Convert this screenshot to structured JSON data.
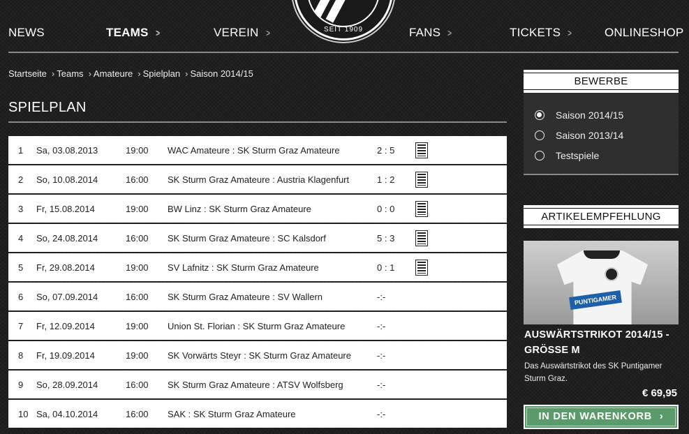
{
  "nav": {
    "items": [
      {
        "label": "NEWS",
        "chevron": false,
        "active": false
      },
      {
        "label": "TEAMS",
        "chevron": true,
        "active": true
      },
      {
        "label": "VEREIN",
        "chevron": true,
        "active": false
      },
      {
        "label": "FANS",
        "chevron": true,
        "active": false
      },
      {
        "label": "TICKETS",
        "chevron": true,
        "active": false
      },
      {
        "label": "ONLINESHOP",
        "chevron": false,
        "active": false
      }
    ],
    "logo_text": "SEIT 1909"
  },
  "breadcrumb": [
    "Startseite",
    "Teams",
    "Amateure",
    "Spielplan",
    "Saison 2014/15"
  ],
  "page_title": "SPIELPLAN",
  "matches": [
    {
      "no": "1",
      "date": "Sa, 03.08.2013",
      "time": "19:00",
      "match": "WAC Amateure : SK Sturm Graz Amateure",
      "score": "2 : 5",
      "report": true
    },
    {
      "no": "2",
      "date": "So, 10.08.2014",
      "time": "16:00",
      "match": "SK Sturm Graz Amateure : Austria Klagenfurt",
      "score": "1 : 2",
      "report": true
    },
    {
      "no": "3",
      "date": "Fr, 15.08.2014",
      "time": "19:00",
      "match": "BW Linz : SK Sturm Graz Amateure",
      "score": "0 : 0",
      "report": true
    },
    {
      "no": "4",
      "date": "So, 24.08.2014",
      "time": "16:00",
      "match": "SK Sturm Graz Amateure : SC Kalsdorf",
      "score": "5 : 3",
      "report": true
    },
    {
      "no": "5",
      "date": "Fr, 29.08.2014",
      "time": "19:00",
      "match": "SV Lafnitz : SK Sturm Graz Amateure",
      "score": "0 : 1",
      "report": true
    },
    {
      "no": "6",
      "date": "So, 07.09.2014",
      "time": "16:00",
      "match": "SK Sturm Graz Amateure : SV Wallern",
      "score": "-:-",
      "report": false
    },
    {
      "no": "7",
      "date": "Fr, 12.09.2014",
      "time": "19:00",
      "match": "Union St. Florian : SK Sturm Graz Amateure",
      "score": "-:-",
      "report": false
    },
    {
      "no": "8",
      "date": "Fr, 19.09.2014",
      "time": "19:00",
      "match": "SK Vorwärts Steyr : SK Sturm Graz Amateure",
      "score": "-:-",
      "report": false
    },
    {
      "no": "9",
      "date": "So, 28.09.2014",
      "time": "16:00",
      "match": "SK Sturm Graz Amateure : ATSV Wolfsberg",
      "score": "-:-",
      "report": false
    },
    {
      "no": "10",
      "date": "Sa, 04.10.2014",
      "time": "16:00",
      "match": "SAK : SK Sturm Graz Amateure",
      "score": "-:-",
      "report": false
    }
  ],
  "sidebar": {
    "bewerbe_title": "BEWERBE",
    "options": [
      {
        "label": "Saison 2014/15",
        "selected": true
      },
      {
        "label": "Saison 2013/14",
        "selected": false
      },
      {
        "label": "Testspiele",
        "selected": false
      }
    ],
    "article_title_heading": "ARTIKELEMPFEHLUNG",
    "article": {
      "sponsor_text": "PUNTIGAMER",
      "name": "AUSWÄRTSTRIKOT 2014/15 - GRÖSSE M",
      "description": "Das Auswärtstrikot des SK Puntigamer Sturm Graz.",
      "price": "€ 69,95",
      "button_label": "IN DEN WARENKORB",
      "button_chevron": "›"
    }
  }
}
